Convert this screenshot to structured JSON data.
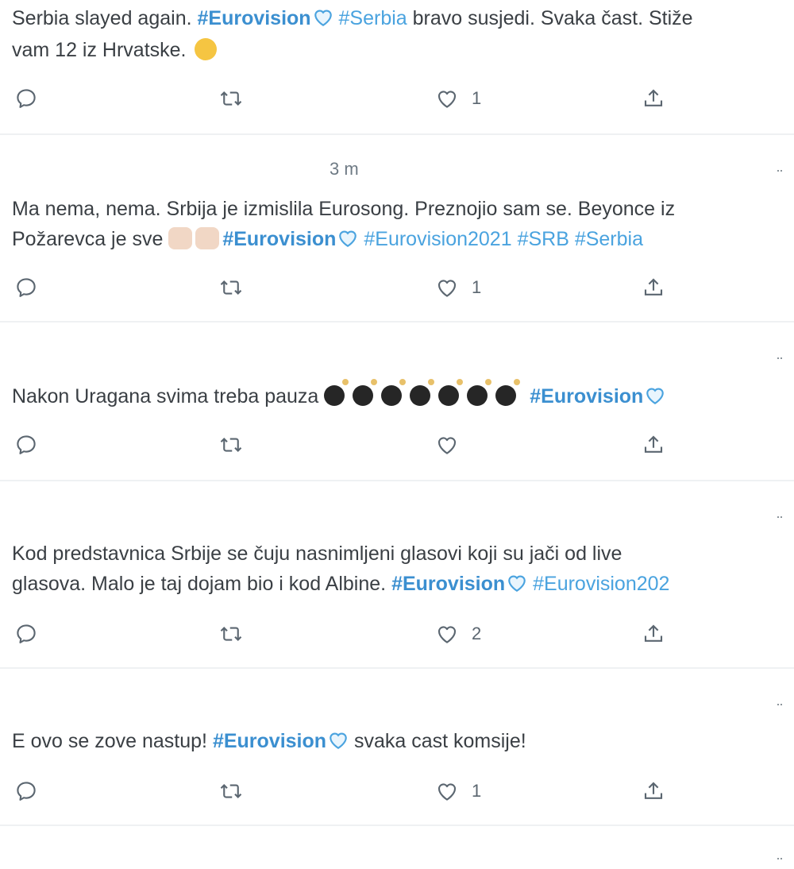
{
  "tweets": [
    {
      "time": "",
      "line1_pre": "Serbia slayed again. ",
      "line1_tag1": "#Eurovision",
      "line1_tag2": "#Serbia",
      "line1_post": " bravo susjedi. Svaka čast. Stiže",
      "line2": "vam 12 iz Hrvatske. ",
      "like_count": "1"
    },
    {
      "time": "3 m",
      "line1": "Ma nema, nema. Srbija je izmislila Eurosong. Preznojio sam se. Beyonce iz",
      "line2_pre": "Požarevca je sve ",
      "line2_tag1": "#Eurovision",
      "line2_tags": "#Eurovision2021 #SRB #Serbia",
      "like_count": "1"
    },
    {
      "text_pre": "Nakon Uragana svima treba pauza ",
      "tag": "#Eurovision",
      "like_count": ""
    },
    {
      "line1": "Kod predstavnica Srbije se čuju nasnimljeni glasovi koji su jači od live",
      "line2_pre": "glasova. Malo je taj dojam bio i kod Albine. ",
      "line2_tag1": "#Eurovision",
      "line2_tag2": "#Eurovision202",
      "like_count": "2"
    },
    {
      "text_pre": "E ovo se zove nastup! ",
      "tag": "#Eurovision",
      "text_post": " svaka cast komsije!",
      "like_count": "1"
    }
  ],
  "more_label": "··",
  "icons": {
    "reply": "reply-icon",
    "retweet": "retweet-icon",
    "like": "heart-icon",
    "share": "share-icon"
  },
  "colors": {
    "hashtag": "#4aa3df",
    "text": "#3a3f44",
    "icon": "#5b6670"
  }
}
